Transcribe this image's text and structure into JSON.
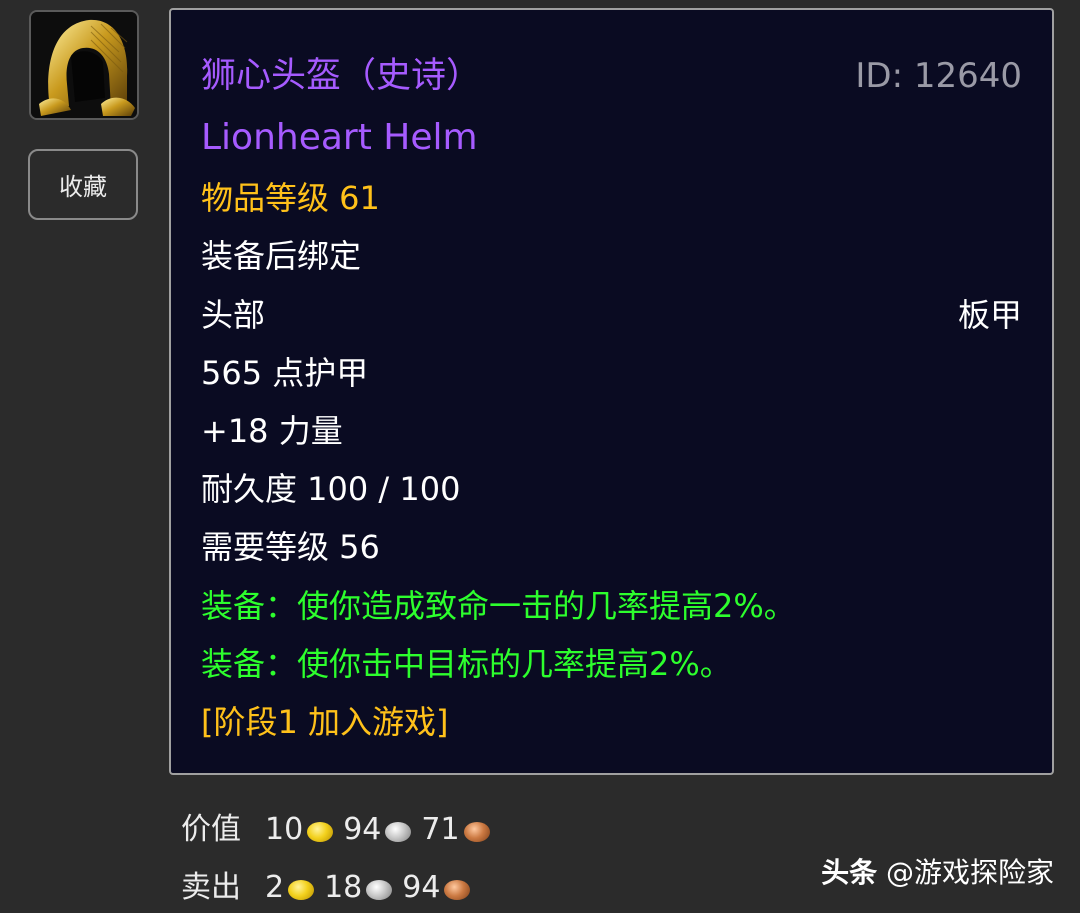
{
  "item": {
    "name_cn": "狮心头盔（史诗）",
    "name_en": "Lionheart Helm",
    "id": "ID: 12640",
    "item_level": "物品等级 61",
    "binding": "装备后绑定",
    "slot": "头部",
    "armor_type": "板甲",
    "armor": "565 点护甲",
    "stat": "+18 力量",
    "durability": "耐久度 100 / 100",
    "required_level": "需要等级 56",
    "equip_effects": [
      "装备：使你造成致命一击的几率提高2%。",
      "装备：使你击中目标的几率提高2%。"
    ],
    "phase": "[阶段1 加入游戏]",
    "icon": "helmet-icon"
  },
  "favorite_button": {
    "label": "收藏"
  },
  "prices": {
    "value": {
      "label": "价值",
      "gold": "10",
      "silver": "94",
      "copper": "71"
    },
    "sell": {
      "label": "卖出",
      "gold": "2",
      "silver": "18",
      "copper": "94"
    }
  },
  "watermark": {
    "brand": "头条",
    "handle": "@游戏探险家"
  },
  "colors": {
    "epic_purple": "#a65bff",
    "item_level_gold": "#ffc11a",
    "equip_green": "#2dff2d",
    "tooltip_bg": "#0a0b22",
    "page_bg": "#2b2b2b"
  }
}
